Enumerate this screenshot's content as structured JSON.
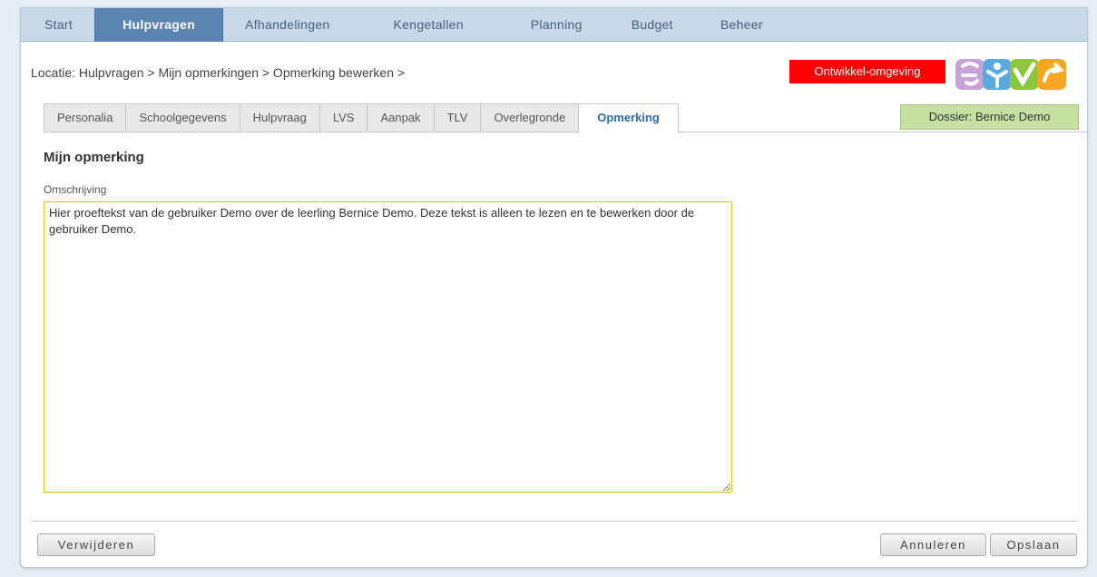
{
  "topnav": {
    "tabs": [
      "Start",
      "Hulpvragen",
      "Afhandelingen",
      "Kengetallen",
      "Planning",
      "Budget",
      "Beheer"
    ],
    "active": "Hulpvragen"
  },
  "breadcrumb": "Locatie: Hulpvragen > Mijn opmerkingen > Opmerking bewerken >",
  "environment_badge": "Ontwikkel-omgeving",
  "subtabs": {
    "tabs": [
      "Personalia",
      "Schoolgegevens",
      "Hulpvraag",
      "LVS",
      "Aanpak",
      "TLV",
      "Overlegronde",
      "Opmerking"
    ],
    "active": "Opmerking"
  },
  "dossier": "Dossier: Bernice Demo",
  "form": {
    "title": "Mijn opmerking",
    "field_label": "Omschrijving",
    "field_value": "Hier proeftekst van de gebruiker Demo over de leerling Bernice Demo. Deze tekst is alleen te lezen en te bewerken door de gebruiker Demo."
  },
  "buttons": {
    "delete": "Verwijderen",
    "cancel": "Annuleren",
    "save": "Opslaan"
  },
  "colors": {
    "nav_active": "#5a84b1",
    "env_badge": "#ff0000",
    "dossier_bg": "#c6e0a3",
    "textarea_focus": "#f0c020"
  }
}
